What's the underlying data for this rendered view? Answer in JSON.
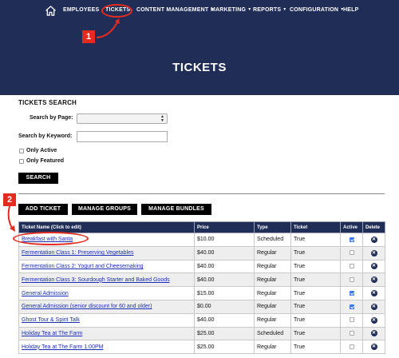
{
  "nav": {
    "home_icon": "home-icon",
    "items": [
      {
        "label": "EMPLOYEES",
        "dropdown": false
      },
      {
        "label": "TICKETS",
        "dropdown": false
      },
      {
        "label": "CONTENT MANAGEMENT",
        "dropdown": true
      },
      {
        "label": "MARKETING",
        "dropdown": true
      },
      {
        "label": "REPORTS",
        "dropdown": true
      },
      {
        "label": "CONFIGURATION",
        "dropdown": true
      },
      {
        "label": "HELP",
        "dropdown": false
      }
    ]
  },
  "page": {
    "title": "TICKETS"
  },
  "annotations": {
    "step1": "1",
    "step2": "2",
    "color": "#e32c1f"
  },
  "search": {
    "title": "TICKETS SEARCH",
    "by_page_label": "Search by Page:",
    "by_page_value": "",
    "by_keyword_label": "Search by Keyword:",
    "keyword_value": "",
    "only_active_label": "Only Active",
    "only_featured_label": "Only Featured",
    "search_button": "SEARCH"
  },
  "actions": {
    "add_ticket": "ADD TICKET",
    "manage_groups": "MANAGE GROUPS",
    "manage_bundles": "MANAGE BUNDLES"
  },
  "table": {
    "headers": {
      "name": "Ticket Name (Click to edit)",
      "price": "Price",
      "type": "Type",
      "ticket": "Ticket",
      "active": "Active",
      "delete": "Delete"
    },
    "rows": [
      {
        "name": "Breakfast with Santa",
        "price": "$10.00",
        "type": "Scheduled",
        "ticket": "True",
        "active": true
      },
      {
        "name": "Fermentation Class 1: Preserving Vegetables",
        "price": "$40.00",
        "type": "Regular",
        "ticket": "True",
        "active": false
      },
      {
        "name": "Fermentation Class 2: Yogurt and Cheesemaking",
        "price": "$40.00",
        "type": "Regular",
        "ticket": "True",
        "active": false
      },
      {
        "name": "Fermentation Class 3: Sourdough Starter and Baked Goods",
        "price": "$40.00",
        "type": "Regular",
        "ticket": "True",
        "active": false
      },
      {
        "name": "General Admission",
        "price": "$15.00",
        "type": "Regular",
        "ticket": "True",
        "active": true
      },
      {
        "name": "General Admission (senior discount for 60 and older)",
        "price": "$0.00",
        "type": "Regular",
        "ticket": "True",
        "active": true
      },
      {
        "name": "Ghost Tour & Spirit Talk",
        "price": "$40.00",
        "type": "Regular",
        "ticket": "True",
        "active": false
      },
      {
        "name": "Holiday Tea at The Farm",
        "price": "$25.00",
        "type": "Scheduled",
        "ticket": "True",
        "active": false
      },
      {
        "name": "Holiday Tea at The Farm 1:00PM",
        "price": "$25.00",
        "type": "Regular",
        "ticket": "True",
        "active": false
      }
    ]
  }
}
